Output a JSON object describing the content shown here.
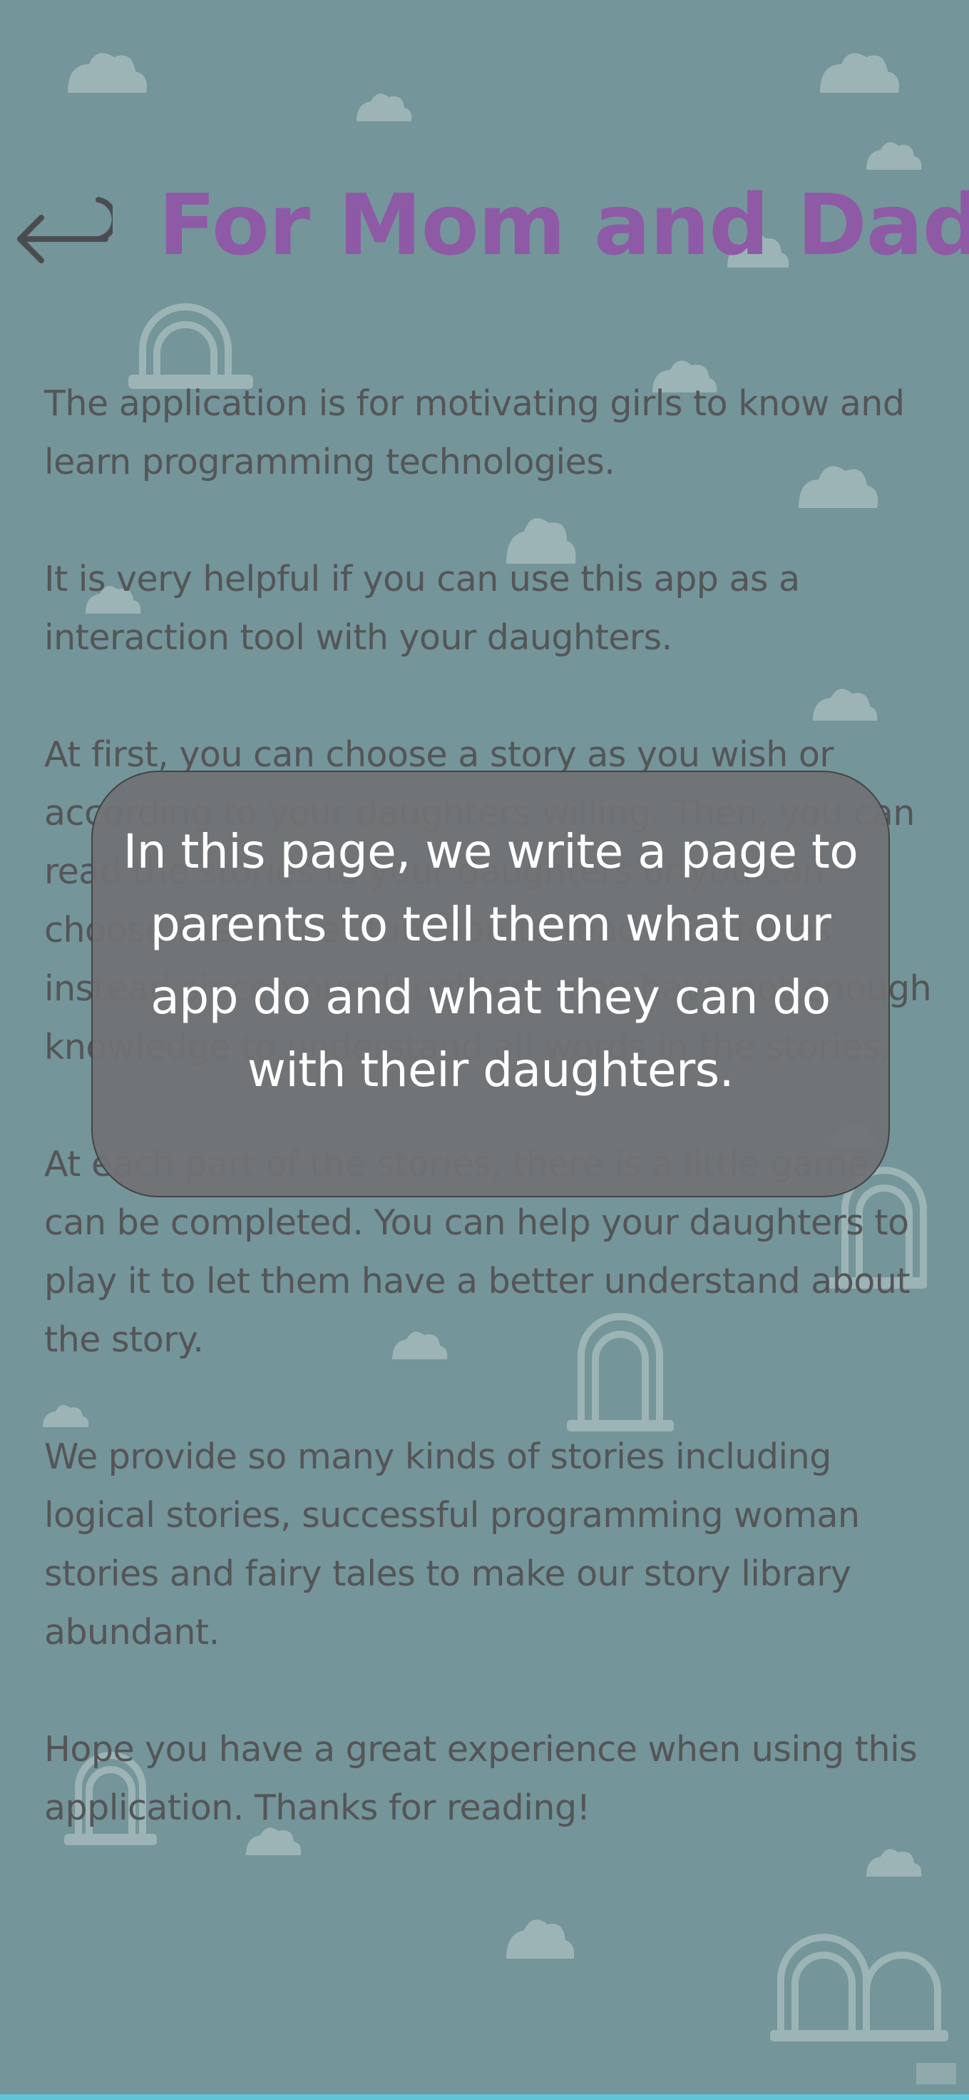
{
  "header": {
    "title": "For Mom and Dad",
    "back_icon": "return-arrow-icon"
  },
  "content": {
    "paragraphs": [
      "The application is for motivating girls to know and learn programming technologies.",
      "It is very helpful if you can use this app as a interaction tool with your daughters.",
      "At first, you can choose a story as you wish or according to your daughters willing. Then, you can read the stories to your daughters or you can choose the\"Voice\" function to read the stories instead since your daughters may have not enough knowledge to understand all words in the stories.",
      "At each part of the stories, there is a little game can be completed. You can help your daughters to play it to let them have a better understand about the story.",
      "We provide so many kinds of stories including logical stories, successful programming woman stories and fairy tales to make our story library abundant.",
      "Hope you  have a great experience when using this application. Thanks for reading!"
    ]
  },
  "tooltip": {
    "text": "In this page, we write a page to parents to tell them what our app do and what they can do with their daughters."
  },
  "colors": {
    "background": "#74959a",
    "title": "#8e5aa6",
    "body_text": "#545557",
    "tooltip_bg": "#707274",
    "tooltip_text": "#ffffff",
    "decor": "#9fb6b8",
    "bottom_strip": "#5ec6d6"
  }
}
